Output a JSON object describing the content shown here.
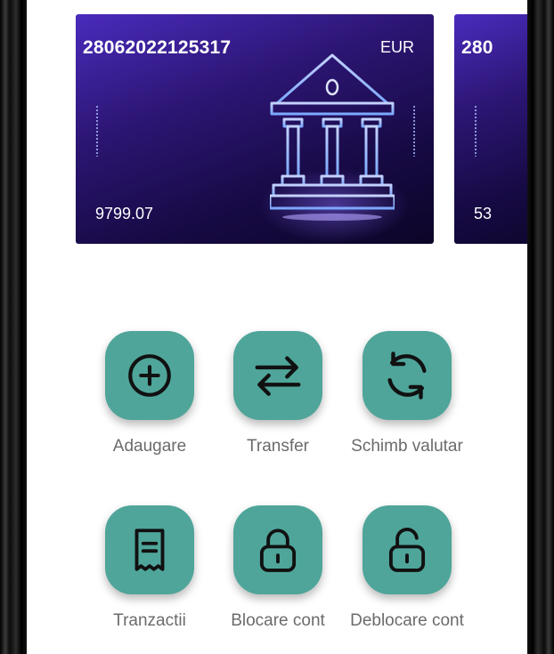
{
  "cards": [
    {
      "account": "28062022125317",
      "currency": "EUR",
      "balance": "9799.07"
    },
    {
      "account": "280",
      "balance": "53"
    }
  ],
  "actions": [
    {
      "label": "Adaugare",
      "icon": "plus-circle-icon"
    },
    {
      "label": "Transfer",
      "icon": "transfer-arrows-icon"
    },
    {
      "label": "Schimb valutar",
      "icon": "refresh-icon"
    },
    {
      "label": "Tranzactii",
      "icon": "receipt-icon"
    },
    {
      "label": "Blocare cont",
      "icon": "lock-icon"
    },
    {
      "label": "Deblocare cont",
      "icon": "unlock-icon"
    }
  ],
  "colors": {
    "action_tile": "#4fa59a",
    "card_start": "#4a2bbd",
    "card_end": "#0c0527",
    "label": "#6b6b6b"
  }
}
